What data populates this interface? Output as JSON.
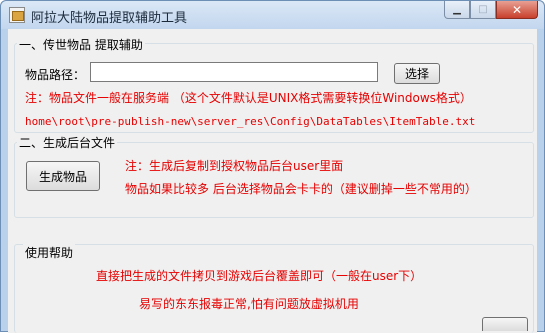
{
  "window": {
    "title": "阿拉大陆物品提取辅助工具",
    "minimize_glyph": "▁",
    "maximize_glyph": "□",
    "close_glyph": "✕"
  },
  "section1": {
    "title": "一、传世物品 提取辅助",
    "path_label": "物品路径：",
    "path_value": "",
    "browse_button": "选择",
    "note": "注：物品文件一般在服务端 （这个文件默认是UNIX格式需要转换位Windows格式）",
    "example_path": "home\\root\\pre-publish-new\\server_res\\Config\\DataTables\\ItemTable.txt"
  },
  "section2": {
    "title": "二、生成后台文件",
    "generate_button": "生成物品",
    "note1": "注：生成后复制到授权物品后台user里面",
    "note2": "物品如果比较多 后台选择物品会卡卡的（建议删掉一些不常用的）"
  },
  "help": {
    "title": "使用帮助",
    "line1": "直接把生成的文件拷贝到游戏后台覆盖即可（一般在user下）",
    "line2": "易写的东东报毒正常,怕有问题放虚拟机用"
  },
  "colors": {
    "note_red": "#e60000",
    "title_bar": "#c2d6ee",
    "client_bg": "#f0f0f0"
  }
}
